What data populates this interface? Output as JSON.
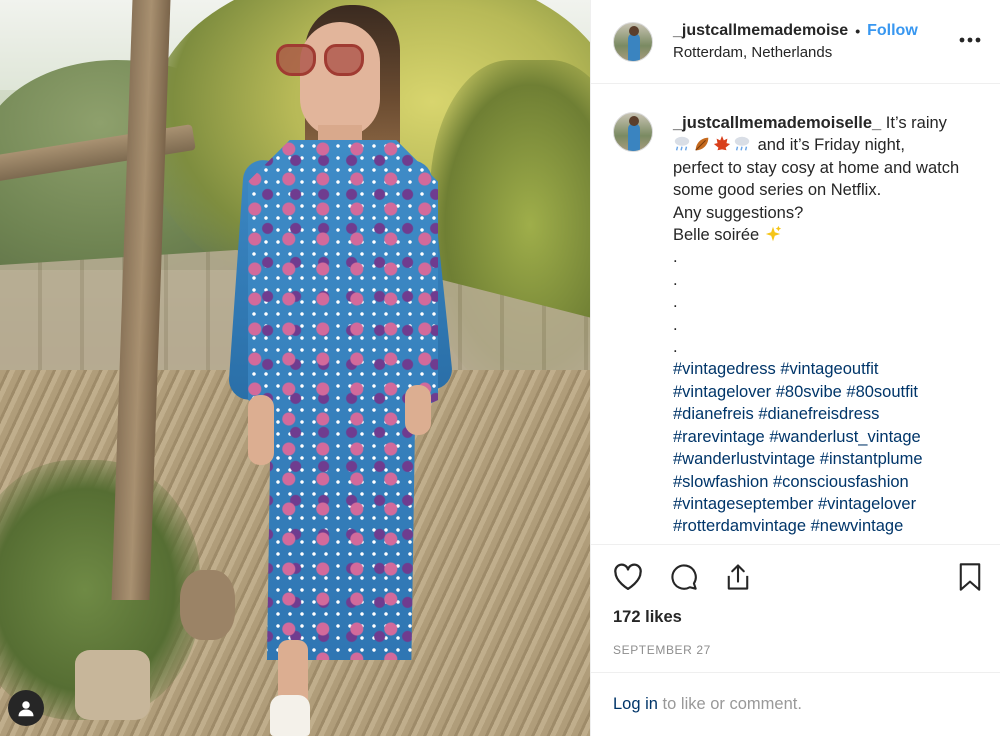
{
  "post": {
    "username": "_justcallmemademoise",
    "separator": "•",
    "follow_label": "Follow",
    "location": "Rotterdam, Netherlands",
    "more_icon": "more-options-icon"
  },
  "caption": {
    "username": "_justcallmemademoiselle_",
    "text_1": " It’s rainy",
    "text_2": " and it’s Friday night,",
    "line_3": "perfect to stay cosy at home and watch",
    "line_4": "some good series on Netflix.",
    "line_5": "Any suggestions?",
    "line_6": "Belle soirée",
    "dots": [
      ".",
      ".",
      ".",
      ".",
      "."
    ],
    "hashtag_lines": [
      [
        "#vintagedress",
        "#vintageoutfit"
      ],
      [
        "#vintagelover",
        "#80svibe",
        "#80soutfit"
      ],
      [
        "#dianefreis",
        "#dianefreisdress"
      ],
      [
        "#rarevintage",
        "#wanderlust_vintage"
      ],
      [
        "#wanderlustvintage",
        "#instantplume"
      ],
      [
        "#slowfashion",
        "#consciousfashion"
      ],
      [
        "#vintageseptember",
        "#vintagelover"
      ],
      [
        "#rotterdamvintage",
        "#newvintage"
      ]
    ],
    "emojis": [
      "rain-cloud-icon",
      "leaves-icon",
      "maple-leaf-icon",
      "rain-cloud-icon",
      "sparkles-icon"
    ]
  },
  "actions": {
    "icons": [
      "heart-icon",
      "comment-icon",
      "share-icon",
      "bookmark-icon"
    ],
    "likes": "172 likes",
    "date": "SEPTEMBER 27"
  },
  "footer": {
    "login_label": "Log in",
    "rest": " to like or comment."
  },
  "colors": {
    "link": "#003569",
    "follow": "#3897f0",
    "text": "#262626",
    "muted": "#8e8e8e"
  }
}
